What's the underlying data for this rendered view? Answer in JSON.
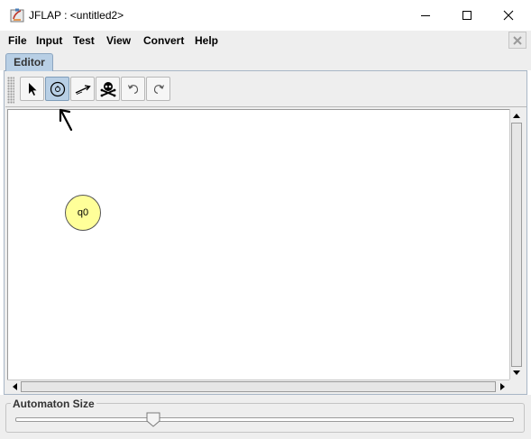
{
  "window": {
    "title": "JFLAP : <untitled2>",
    "icons": {
      "app": "jflap-app-icon",
      "minimize": "minimize-icon",
      "maximize": "maximize-icon",
      "close": "close-icon"
    }
  },
  "menubar": {
    "items": [
      "File",
      "Input",
      "Test",
      "View",
      "Convert",
      "Help"
    ],
    "close_document_icon": "close-icon"
  },
  "tabs": [
    {
      "label": "Editor",
      "active": true
    }
  ],
  "toolbar": {
    "tools": [
      {
        "name": "attribute-editor",
        "icon": "pointer-arrow-icon",
        "selected": false
      },
      {
        "name": "state-creator",
        "icon": "state-circle-icon",
        "selected": true
      },
      {
        "name": "transition-creator",
        "icon": "transition-arrow-icon",
        "selected": false
      },
      {
        "name": "deleter",
        "icon": "skull-crossbones-icon",
        "selected": false
      },
      {
        "name": "undo",
        "icon": "undo-icon",
        "selected": false
      },
      {
        "name": "redo",
        "icon": "redo-icon",
        "selected": false
      }
    ]
  },
  "canvas": {
    "states": [
      {
        "label": "q0",
        "fill": "#ffff99"
      }
    ],
    "annotation": "hand-drawn-arrow-pointing-at-state-tool"
  },
  "automaton_size": {
    "label": "Automaton Size",
    "value_fraction": 0.27
  },
  "colors": {
    "selected_tool": "#b8cfe5",
    "state_fill": "#ffff99",
    "tab_active": "#b8cfe5"
  }
}
